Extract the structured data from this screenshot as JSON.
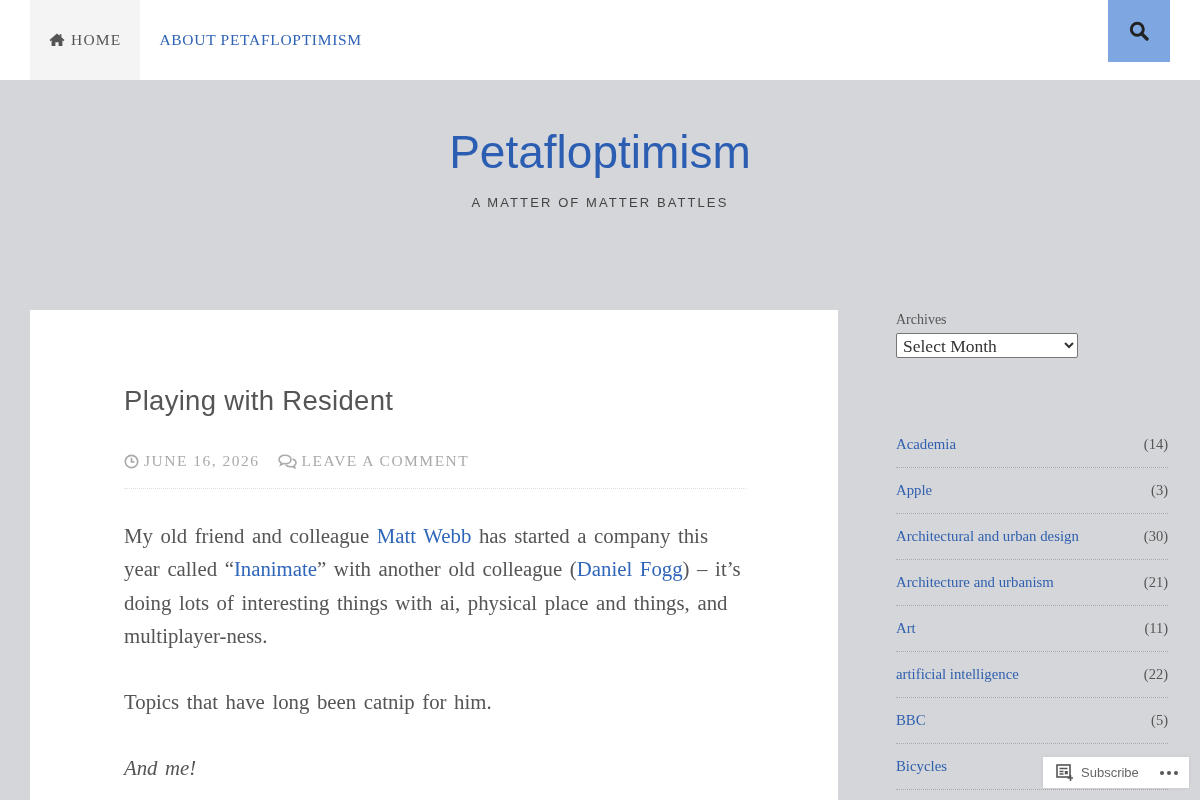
{
  "nav": {
    "items": [
      {
        "label": "HOME",
        "kind": "home",
        "selected": true
      },
      {
        "label": "ABOUT PETAFLOPTIMISM",
        "kind": "page",
        "selected": false
      }
    ]
  },
  "site": {
    "title": "Petafloptimism",
    "tagline": "A MATTER OF MATTER BATTLES"
  },
  "post": {
    "title": "Playing with Resident",
    "meta": [
      {
        "kind": "date",
        "label": "JUNE 16, 2026"
      },
      {
        "kind": "comments",
        "label": "LEAVE A COMMENT"
      }
    ],
    "paragraphs": [
      {
        "kind": "plain",
        "segments": [
          {
            "kind": "text",
            "text": "My old friend and colleague "
          },
          {
            "kind": "link",
            "text": "Matt Webb"
          },
          {
            "kind": "text",
            "text": " has started a company this year called “"
          },
          {
            "kind": "link",
            "text": "Inanimate"
          },
          {
            "kind": "text",
            "text": "” with another old colleague ("
          },
          {
            "kind": "link",
            "text": "Daniel Fogg"
          },
          {
            "kind": "text",
            "text": ") – it’s doing lots of interesting things with ai, physical place and things, and multiplayer-ness."
          }
        ]
      },
      {
        "kind": "plain",
        "segments": [
          {
            "kind": "text",
            "text": "Topics that have long been catnip for him."
          }
        ]
      },
      {
        "kind": "emphasis",
        "segments": [
          {
            "kind": "text",
            "text": "And me!"
          }
        ]
      }
    ]
  },
  "sidebar": {
    "archives": {
      "title": "Archives",
      "value": "Select Month"
    },
    "categories": [
      {
        "name": "Academia",
        "count": "(14)"
      },
      {
        "name": "Apple",
        "count": "(3)"
      },
      {
        "name": "Architectural and urban design",
        "count": "(30)"
      },
      {
        "name": "Architecture and urbanism",
        "count": "(21)"
      },
      {
        "name": "Art",
        "count": "(11)"
      },
      {
        "name": "artificial intelligence",
        "count": "(22)"
      },
      {
        "name": "BBC",
        "count": "(5)"
      },
      {
        "name": "Bicycles"
      }
    ]
  },
  "subscribe": {
    "label": "Subscribe"
  }
}
